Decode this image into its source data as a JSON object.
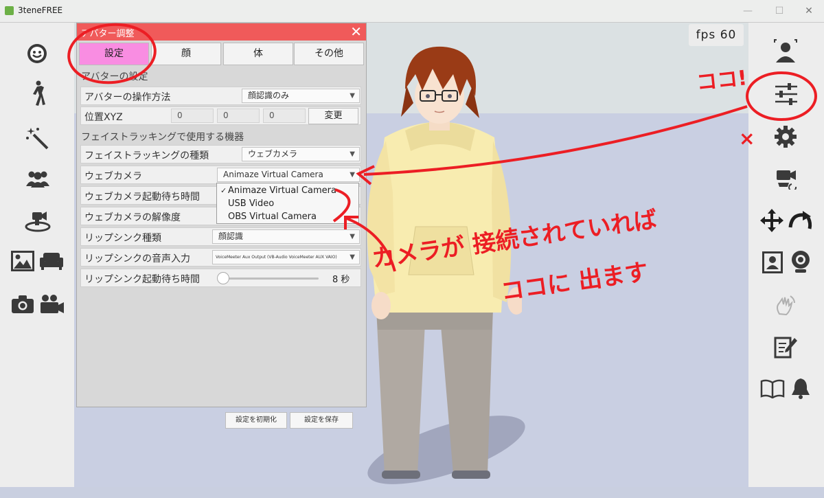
{
  "window": {
    "title": "3teneFREE",
    "minimize_glyph": "—",
    "maximize_glyph": "☐",
    "close_glyph": "✕"
  },
  "fps": "fps  60",
  "left_sidebar_icons": [
    "smiley-icon",
    "pose-figure-icon",
    "magic-wand-icon",
    "group-people-icon",
    "camera-stage-icon",
    "image-icon",
    "sofa-icon",
    "photo-camera-icon",
    "video-camera-icon"
  ],
  "right_sidebar_icons": [
    "face-scan-icon",
    "sliders-icon",
    "gear-icon",
    "camera-rotate-icon",
    "move-arrows-icon",
    "rotate-arrow-icon",
    "portrait-icon",
    "webcam-icon",
    "hand-wave-icon",
    "edit-note-icon",
    "book-icon",
    "bell-icon"
  ],
  "panel": {
    "title": "アバター調整",
    "close": "✕",
    "tabs": [
      "設定",
      "顔",
      "体",
      "その他"
    ],
    "section_avatar": "アバターの設定",
    "operation_label": "アバターの操作方法",
    "operation_value": "顔認識のみ",
    "position_label": "位置XYZ",
    "position_values": [
      "0",
      "0",
      "0"
    ],
    "change_button": "変更",
    "section_device": "フェイストラッキングで使用する機器",
    "tracking_type_label": "フェイストラッキングの種類",
    "tracking_type_value": "ウェブカメラ",
    "webcam_label": "ウェブカメラ",
    "webcam_value": "Animaze Virtual Camera",
    "webcam_wait_label": "ウェブカメラ起動待ち時間",
    "webcam_resolution_label": "ウェブカメラの解像度",
    "lipsync_type_label": "リップシンク種類",
    "lipsync_type_value": "顔認識",
    "lipsync_input_label": "リップシンクの音声入力",
    "lipsync_input_value": "VoiceMeeter Aux Output (VB-Audio VoiceMeeter AUX VAIO)",
    "lipsync_wait_label": "リップシンク起動待ち時間",
    "lipsync_wait_value": "8 秒",
    "lipsync_wait_level": 0.05,
    "reset_button": "設定を初期化",
    "save_button": "設定を保存"
  },
  "dropdown": {
    "options": [
      "Animaze Virtual Camera",
      "USB Video",
      "OBS Virtual Camera"
    ],
    "selected": "Animaze Virtual Camera",
    "check": "✓"
  },
  "annotations": {
    "koko_top": "ココ!",
    "handwritten_line1": "カメラが 接続されていれば",
    "handwritten_line2": "ココに 出ます",
    "mark": "×",
    "color": "#ec1e24"
  },
  "colors": {
    "header": "#f05a5a",
    "active_tab": "#f98de2"
  }
}
